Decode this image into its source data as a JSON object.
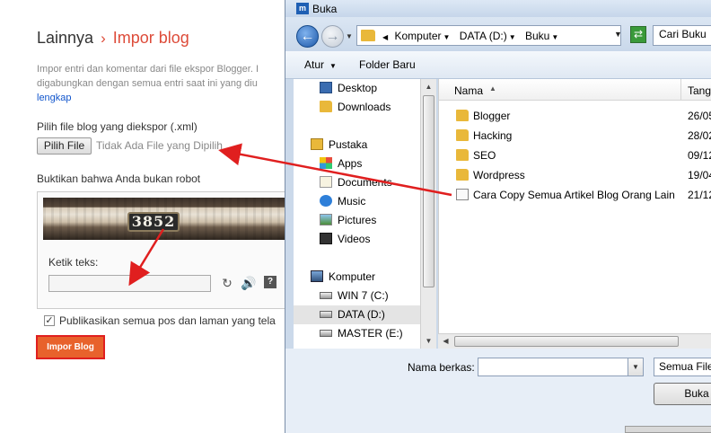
{
  "blogger": {
    "breadcrumb_parent": "Lainnya",
    "breadcrumb_sep": "›",
    "breadcrumb_current": "Impor blog",
    "desc_line1": "Impor entri dan komentar dari file ekspor Blogger. I",
    "desc_line2": "digabungkan dengan semua entri saat ini yang diu",
    "desc_link": "lengkap",
    "file_label": "Pilih file blog yang diekspor (.xml)",
    "choose_button": "Pilih File",
    "no_file": "Tidak Ada File yang Dipilih",
    "robot_label": "Buktikan bahwa Anda bukan robot",
    "captcha_word": "3852",
    "type_text_label": "Ketik teks:",
    "captcha_input_value": "",
    "publish_label": "Publikasikan semua pos dan laman yang tela",
    "publish_checked": true,
    "import_button": "Impor Blog"
  },
  "dialog": {
    "title": "Buka",
    "app_icon_text": "m",
    "breadcrumbs": [
      "Komputer",
      "DATA (D:)",
      "Buku"
    ],
    "search_placeholder": "Cari Buku",
    "toolbar": {
      "organize": "Atur",
      "new_folder": "Folder Baru"
    },
    "nav_items": [
      {
        "label": "Desktop",
        "icon": "desktop-icon"
      },
      {
        "label": "Downloads",
        "icon": "folder-icon"
      },
      {
        "label": "Pustaka",
        "icon": "library-icon"
      },
      {
        "label": "Apps",
        "icon": "apps-icon"
      },
      {
        "label": "Documents",
        "icon": "documents-icon"
      },
      {
        "label": "Music",
        "icon": "music-icon"
      },
      {
        "label": "Pictures",
        "icon": "pictures-icon"
      },
      {
        "label": "Videos",
        "icon": "videos-icon"
      },
      {
        "label": "Komputer",
        "icon": "computer-icon"
      },
      {
        "label": "WIN 7 (C:)",
        "icon": "drive-icon"
      },
      {
        "label": "DATA (D:)",
        "icon": "drive-icon"
      },
      {
        "label": "MASTER (E:)",
        "icon": "drive-icon"
      }
    ],
    "columns": {
      "name": "Nama",
      "date": "Tang"
    },
    "files": [
      {
        "name": "Blogger",
        "date": "26/05",
        "type": "folder"
      },
      {
        "name": "Hacking",
        "date": "28/02",
        "type": "folder"
      },
      {
        "name": "SEO",
        "date": "09/12",
        "type": "folder"
      },
      {
        "name": "Wordpress",
        "date": "19/04",
        "type": "folder"
      },
      {
        "name": "Cara Copy Semua Artikel Blog Orang Lain",
        "date": "21/12",
        "type": "file"
      }
    ],
    "filename_label": "Nama berkas:",
    "filename_value": "",
    "filetype_value": "Semua File",
    "open_button": "Buka"
  },
  "colors": {
    "accent_orange": "#e8622c",
    "highlight_red": "#e01f1f",
    "link_blue": "#1155cc"
  }
}
